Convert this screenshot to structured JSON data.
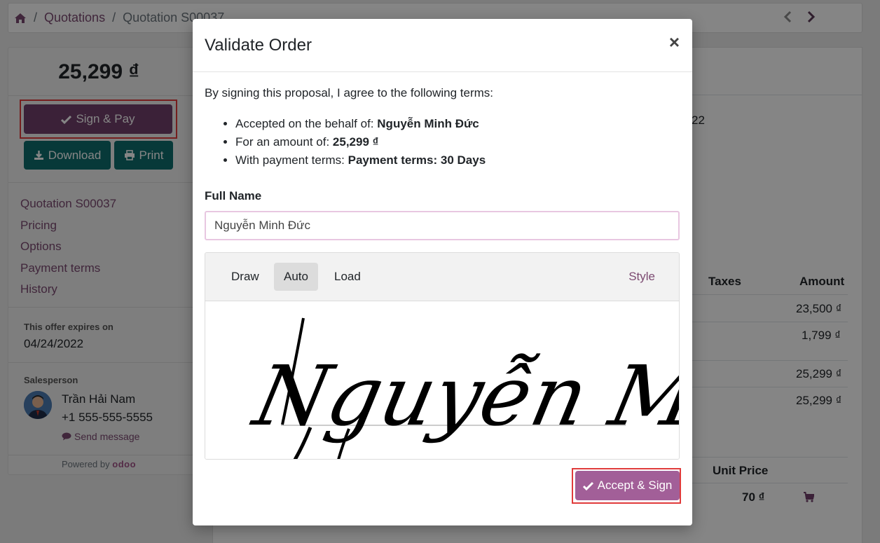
{
  "breadcrumb": {
    "home_icon": "home-icon",
    "items": [
      "Quotations",
      "Quotation S00037"
    ],
    "separator": "/"
  },
  "sidebar": {
    "total": "25,299 ₫",
    "sign_pay_label": "Sign & Pay",
    "download_label": "Download",
    "print_label": "Print",
    "nav": [
      "Quotation S00037",
      "Pricing",
      "Options",
      "Payment terms",
      "History"
    ],
    "expires_label": "This offer expires on",
    "expires_date": "04/24/2022",
    "salesperson_label": "Salesperson",
    "salesperson_name": "Trần Hải Nam",
    "salesperson_phone": "+1 555-555-5555",
    "send_message_label": "Send message",
    "powered_by": "Powered by",
    "powered_brand": "odoo"
  },
  "background": {
    "date_fragment": "22",
    "table1_headers": [
      "Taxes",
      "Amount"
    ],
    "table1_amounts": [
      "23,500 ₫",
      "1,799 ₫",
      "25,299 ₫",
      "25,299 ₫"
    ],
    "table2_header": "Unit Price",
    "table2_price": "70 ₫"
  },
  "modal": {
    "title": "Validate Order",
    "close_symbol": "×",
    "intro": "By signing this proposal, I agree to the following terms:",
    "terms": [
      {
        "label": "Accepted on the behalf of:",
        "value": "Nguyễn Minh Đức"
      },
      {
        "label": "For an amount of:",
        "value": "25,299 ₫"
      },
      {
        "label": "With payment terms:",
        "value": "Payment terms: 30 Days"
      }
    ],
    "full_name_label": "Full Name",
    "full_name_value": "Nguyễn Minh Đức",
    "sig_tabs": [
      "Draw",
      "Auto",
      "Load"
    ],
    "sig_active_tab": "Auto",
    "style_label": "Style",
    "signature_text": "Nguyễn Minh Đức",
    "accept_label": "Accept & Sign"
  },
  "colors": {
    "primary": "#71406b",
    "accept": "#a25f98",
    "teal": "#0e6e6e",
    "highlight": "#e03b3b"
  }
}
